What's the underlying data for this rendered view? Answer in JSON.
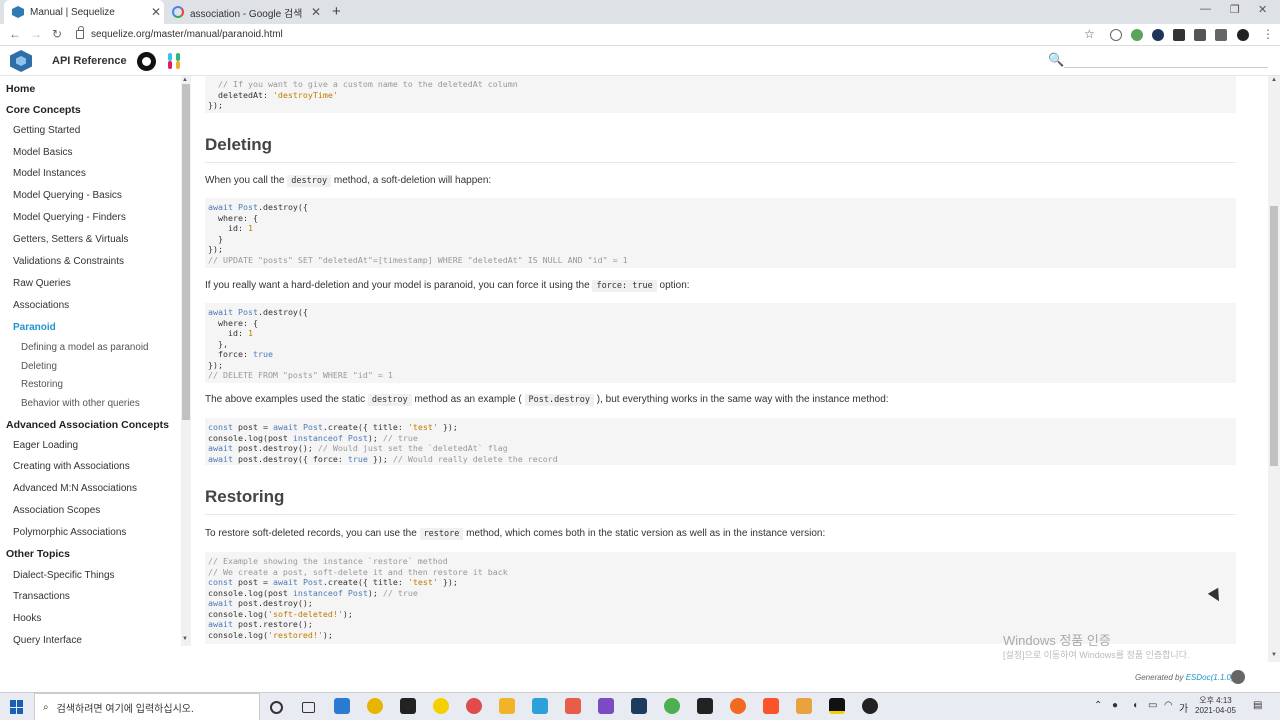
{
  "browser": {
    "tabs": [
      {
        "title": "Manual | Sequelize"
      },
      {
        "title": "association - Google 검색"
      }
    ],
    "url": "sequelize.org/master/manual/paranoid.html"
  },
  "header": {
    "api_reference": "API Reference",
    "search_placeholder": ""
  },
  "sidebar": {
    "items": [
      {
        "label": "Home",
        "kind": "section"
      },
      {
        "label": "Core Concepts",
        "kind": "section"
      },
      {
        "label": "Getting Started",
        "kind": "sub"
      },
      {
        "label": "Model Basics",
        "kind": "sub"
      },
      {
        "label": "Model Instances",
        "kind": "sub"
      },
      {
        "label": "Model Querying - Basics",
        "kind": "sub"
      },
      {
        "label": "Model Querying - Finders",
        "kind": "sub"
      },
      {
        "label": "Getters, Setters & Virtuals",
        "kind": "sub"
      },
      {
        "label": "Validations & Constraints",
        "kind": "sub"
      },
      {
        "label": "Raw Queries",
        "kind": "sub"
      },
      {
        "label": "Associations",
        "kind": "sub"
      },
      {
        "label": "Paranoid",
        "kind": "sub",
        "active": true
      },
      {
        "label": "Defining a model as paranoid",
        "kind": "sub2"
      },
      {
        "label": "Deleting",
        "kind": "sub2"
      },
      {
        "label": "Restoring",
        "kind": "sub2"
      },
      {
        "label": "Behavior with other queries",
        "kind": "sub2"
      },
      {
        "label": "Advanced Association Concepts",
        "kind": "section"
      },
      {
        "label": "Eager Loading",
        "kind": "sub"
      },
      {
        "label": "Creating with Associations",
        "kind": "sub"
      },
      {
        "label": "Advanced M:N Associations",
        "kind": "sub"
      },
      {
        "label": "Association Scopes",
        "kind": "sub"
      },
      {
        "label": "Polymorphic Associations",
        "kind": "sub"
      },
      {
        "label": "Other Topics",
        "kind": "section"
      },
      {
        "label": "Dialect-Specific Things",
        "kind": "sub"
      },
      {
        "label": "Transactions",
        "kind": "sub"
      },
      {
        "label": "Hooks",
        "kind": "sub"
      },
      {
        "label": "Query Interface",
        "kind": "sub"
      }
    ]
  },
  "content": {
    "code0": [
      [
        [
          "cm",
          "  // If you want to give a custom name to the deletedAt column"
        ]
      ],
      [
        [
          "",
          "  deletedAt: "
        ],
        [
          "st",
          "'destroyTime'"
        ]
      ],
      [
        [
          "",
          "});"
        ]
      ]
    ],
    "h_deleting": "Deleting",
    "p1": {
      "pre": "When you call the ",
      "code": "destroy",
      "post": " method, a soft-deletion will happen:"
    },
    "code1": [
      [
        [
          "kw",
          "await "
        ],
        [
          "kw",
          "Post"
        ],
        [
          "",
          ".destroy({"
        ]
      ],
      [
        [
          "",
          "  where: {"
        ]
      ],
      [
        [
          "",
          "    id: "
        ],
        [
          "nm",
          "1"
        ]
      ],
      [
        [
          "",
          "  }"
        ]
      ],
      [
        [
          "",
          "});"
        ]
      ],
      [
        [
          "cm",
          "// UPDATE \"posts\" SET \"deletedAt\"=[timestamp] WHERE \"deletedAt\" IS NULL AND \"id\" = 1"
        ]
      ]
    ],
    "p2": {
      "pre": "If you really want a hard-deletion and your model is paranoid, you can force it using the ",
      "code": "force: true",
      "post": " option:"
    },
    "code2": [
      [
        [
          "kw",
          "await "
        ],
        [
          "kw",
          "Post"
        ],
        [
          "",
          ".destroy({"
        ]
      ],
      [
        [
          "",
          "  where: {"
        ]
      ],
      [
        [
          "",
          "    id: "
        ],
        [
          "nm",
          "1"
        ]
      ],
      [
        [
          "",
          "  },"
        ]
      ],
      [
        [
          "",
          "  force: "
        ],
        [
          "kw",
          "true"
        ]
      ],
      [
        [
          "",
          "});"
        ]
      ],
      [
        [
          "cm",
          "// DELETE FROM \"posts\" WHERE \"id\" = 1"
        ]
      ]
    ],
    "p3": {
      "pre": "The above examples used the static ",
      "code": "destroy",
      "mid": " method as an example ( ",
      "code2": "Post.destroy",
      "post": " ), but everything works in the same way with the instance method:"
    },
    "code3": [
      [
        [
          "kw",
          "const "
        ],
        [
          "",
          "post = "
        ],
        [
          "kw",
          "await "
        ],
        [
          "kw",
          "Post"
        ],
        [
          "",
          ".create({ title: "
        ],
        [
          "st",
          "'test'"
        ],
        [
          "",
          " });"
        ]
      ],
      [
        [
          "",
          "console.log(post "
        ],
        [
          "kw",
          "instanceof "
        ],
        [
          "kw",
          "Post"
        ],
        [
          "",
          "); "
        ],
        [
          "cm",
          "// true"
        ]
      ],
      [
        [
          "kw",
          "await "
        ],
        [
          "",
          "post.destroy(); "
        ],
        [
          "cm",
          "// Would just set the `deletedAt` flag"
        ]
      ],
      [
        [
          "kw",
          "await "
        ],
        [
          "",
          "post.destroy({ force: "
        ],
        [
          "kw",
          "true"
        ],
        [
          "",
          " }); "
        ],
        [
          "cm",
          "// Would really delete the record"
        ]
      ]
    ],
    "h_restoring": "Restoring",
    "p4": {
      "pre": "To restore soft-deleted records, you can use the ",
      "code": "restore",
      "post": " method, which comes both in the static version as well as in the instance version:"
    },
    "code4": [
      [
        [
          "cm",
          "// Example showing the instance `restore` method"
        ]
      ],
      [
        [
          "cm",
          "// We create a post, soft-delete it and then restore it back"
        ]
      ],
      [
        [
          "kw",
          "const "
        ],
        [
          "",
          "post = "
        ],
        [
          "kw",
          "await "
        ],
        [
          "kw",
          "Post"
        ],
        [
          "",
          ".create({ title: "
        ],
        [
          "st",
          "'test'"
        ],
        [
          "",
          " });"
        ]
      ],
      [
        [
          "",
          "console.log(post "
        ],
        [
          "kw",
          "instanceof "
        ],
        [
          "kw",
          "Post"
        ],
        [
          "",
          "); "
        ],
        [
          "cm",
          "// true"
        ]
      ],
      [
        [
          "kw",
          "await "
        ],
        [
          "",
          "post.destroy();"
        ]
      ],
      [
        [
          "",
          "console.log("
        ],
        [
          "st",
          "'soft-deleted!'"
        ],
        [
          "",
          ");"
        ]
      ],
      [
        [
          "kw",
          "await "
        ],
        [
          "",
          "post.restore();"
        ]
      ],
      [
        [
          "",
          "console.log("
        ],
        [
          "st",
          "'restored!'"
        ],
        [
          "",
          ");"
        ]
      ]
    ]
  },
  "watermark": {
    "line1": "Windows 정품 인증",
    "line2": "[설정]으로 이동하여 Windows를 정품 인증합니다."
  },
  "footer": {
    "pre": "Generated by ",
    "link": "ESDoc(1.1.0)"
  },
  "taskbar": {
    "search_text": "검색하려면 여기에 입력하십시오.",
    "ime": "가",
    "time": "오후 4:13",
    "date": "2021-04-05"
  }
}
